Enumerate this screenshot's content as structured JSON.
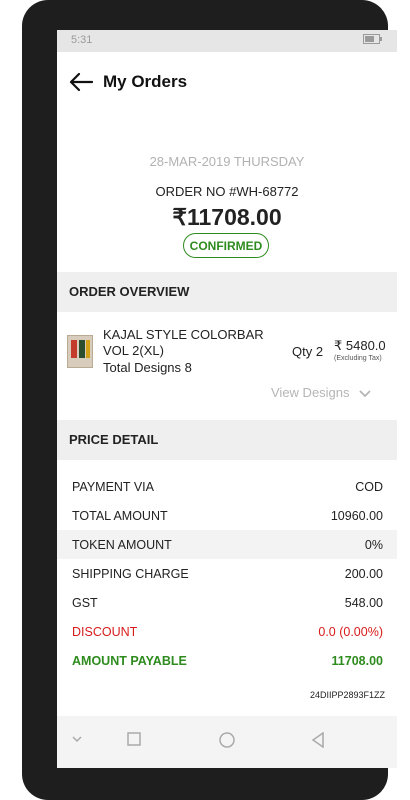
{
  "status_bar": {
    "time": "5:31"
  },
  "app_bar": {
    "title": "My Orders"
  },
  "order": {
    "date": "28-MAR-2019 THURSDAY",
    "order_no": "ORDER NO #WH-68772",
    "amount": "₹11708.00",
    "status": "CONFIRMED"
  },
  "overview": {
    "header": "ORDER OVERVIEW",
    "item": {
      "name": "KAJAL STYLE COLORBAR VOL 2(XL)",
      "designs": "Total Designs 8",
      "qty": "Qty 2",
      "price": "₹ 5480.0",
      "price_note": "(Excluding Tax)"
    },
    "view_designs": "View Designs"
  },
  "price_detail": {
    "header": "PRICE DETAIL",
    "rows": [
      {
        "label": "PAYMENT VIA",
        "value": "COD"
      },
      {
        "label": "TOTAL AMOUNT",
        "value": "10960.00"
      },
      {
        "label": "TOKEN AMOUNT",
        "value": "0%"
      },
      {
        "label": "SHIPPING CHARGE",
        "value": "200.00"
      },
      {
        "label": "GST",
        "value": "548.00"
      },
      {
        "label": "DISCOUNT",
        "value": "0.0 (0.00%)"
      },
      {
        "label": "AMOUNT PAYABLE",
        "value": "11708.00"
      }
    ],
    "gst_code": "24DIIPP2893F1ZZ"
  },
  "colors": {
    "accent_green": "#2e8b1e",
    "discount_red": "#d81b1b"
  }
}
